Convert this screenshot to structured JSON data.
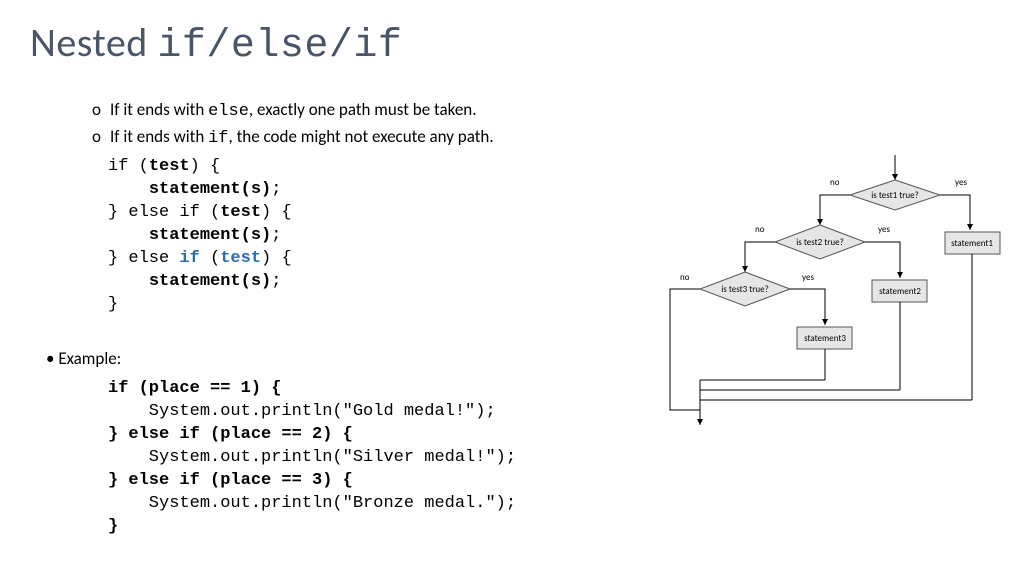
{
  "title": {
    "word1": "Nested ",
    "code": "if/else/if"
  },
  "bullets": {
    "line1a": "If it ends with ",
    "line1code": "else",
    "line1b": ", exactly one path must be taken.",
    "line2a": "If it ends with ",
    "line2code": "if",
    "line2b": ", the code might not execute any path."
  },
  "syntax": {
    "l1a": "if (",
    "l1b": "test",
    "l1c": ") {",
    "l2": "statement(s)",
    "l2b": ";",
    "l3a": "} else if (",
    "l3b": "test",
    "l3c": ") {",
    "l4": "statement(s)",
    "l4b": ";",
    "l5a": "} else ",
    "l5b": "if",
    "l5c": " (",
    "l5d": "test",
    "l5e": ") {",
    "l6": "statement(s)",
    "l6b": ";",
    "l7": "}"
  },
  "exampleLabel": "Example:",
  "example": {
    "l1": "if (place == 1) {",
    "l2": "    System.out.println(\"Gold medal!\");",
    "l3": "} else if (place == 2) {",
    "l4": "    System.out.println(\"Silver medal!\");",
    "l5": "} else if (place == 3) {",
    "l6": "    System.out.println(\"Bronze medal.\");",
    "l7": "}"
  },
  "flow": {
    "test1": "is test1 true?",
    "test2": "is test2 true?",
    "test3": "is test3 true?",
    "s1": "statement1",
    "s2": "statement2",
    "s3": "statement3",
    "yes": "yes",
    "no": "no"
  }
}
